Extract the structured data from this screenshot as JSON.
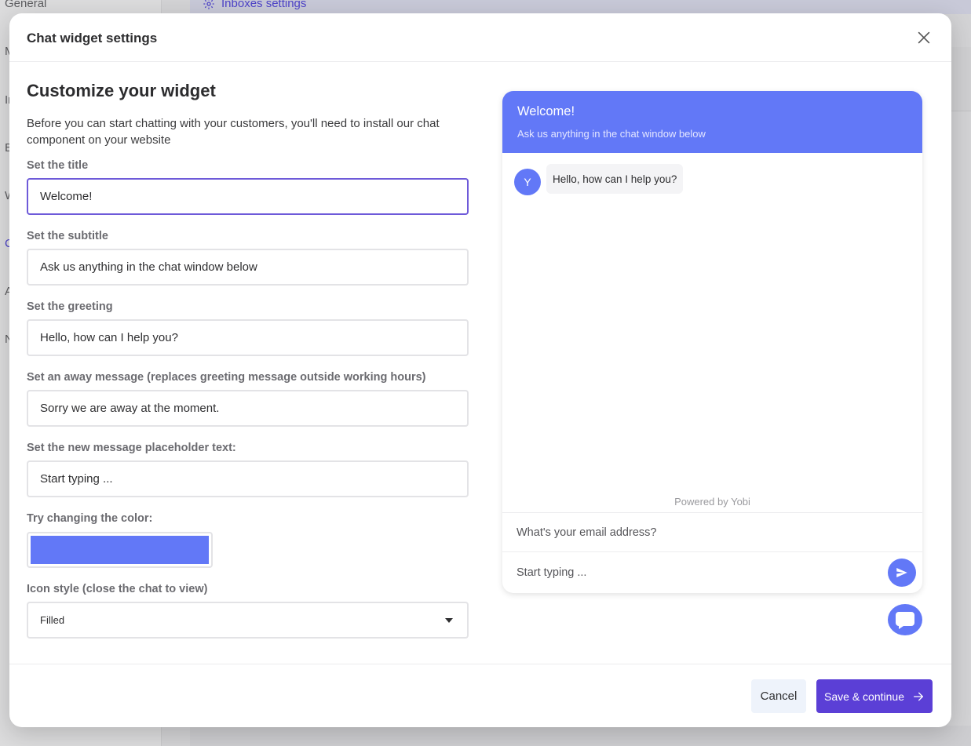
{
  "background": {
    "sidebar_items": [
      "General",
      "M",
      "In",
      "B",
      "W",
      "C",
      "A",
      "N"
    ],
    "breadcrumb": "Inboxes settings"
  },
  "modal": {
    "title": "Chat widget settings",
    "heading": "Customize your widget",
    "description": "Before you can start chatting with your customers, you'll need to install our chat component on your website",
    "fields": {
      "title": {
        "label": "Set the title",
        "value": "Welcome!"
      },
      "subtitle": {
        "label": "Set the subtitle",
        "value": "Ask us anything in the chat window below"
      },
      "greeting": {
        "label": "Set the greeting",
        "value": "Hello, how can I help you?"
      },
      "away": {
        "label": "Set an away message (replaces greeting message outside working hours)",
        "value": "Sorry we are away at the moment."
      },
      "placeholder": {
        "label": "Set the new message placeholder text:",
        "value": "Start typing ..."
      }
    },
    "color": {
      "label": "Try changing the color:",
      "value": "#6278f7"
    },
    "icon_style": {
      "label": "Icon style (close the chat to view)",
      "value": "Filled"
    },
    "buttons": {
      "cancel": "Cancel",
      "save": "Save & continue"
    }
  },
  "preview": {
    "title": "Welcome!",
    "subtitle": "Ask us anything in the chat window below",
    "avatar_letter": "Y",
    "greeting": "Hello, how can I help you?",
    "powered_by": "Powered by Yobi",
    "email_placeholder": "What's your email address?",
    "message_placeholder": "Start typing ..."
  },
  "colors": {
    "accent": "#6278f7",
    "primary_button": "#5b3fd6",
    "focus_border": "#6e5ad9"
  }
}
